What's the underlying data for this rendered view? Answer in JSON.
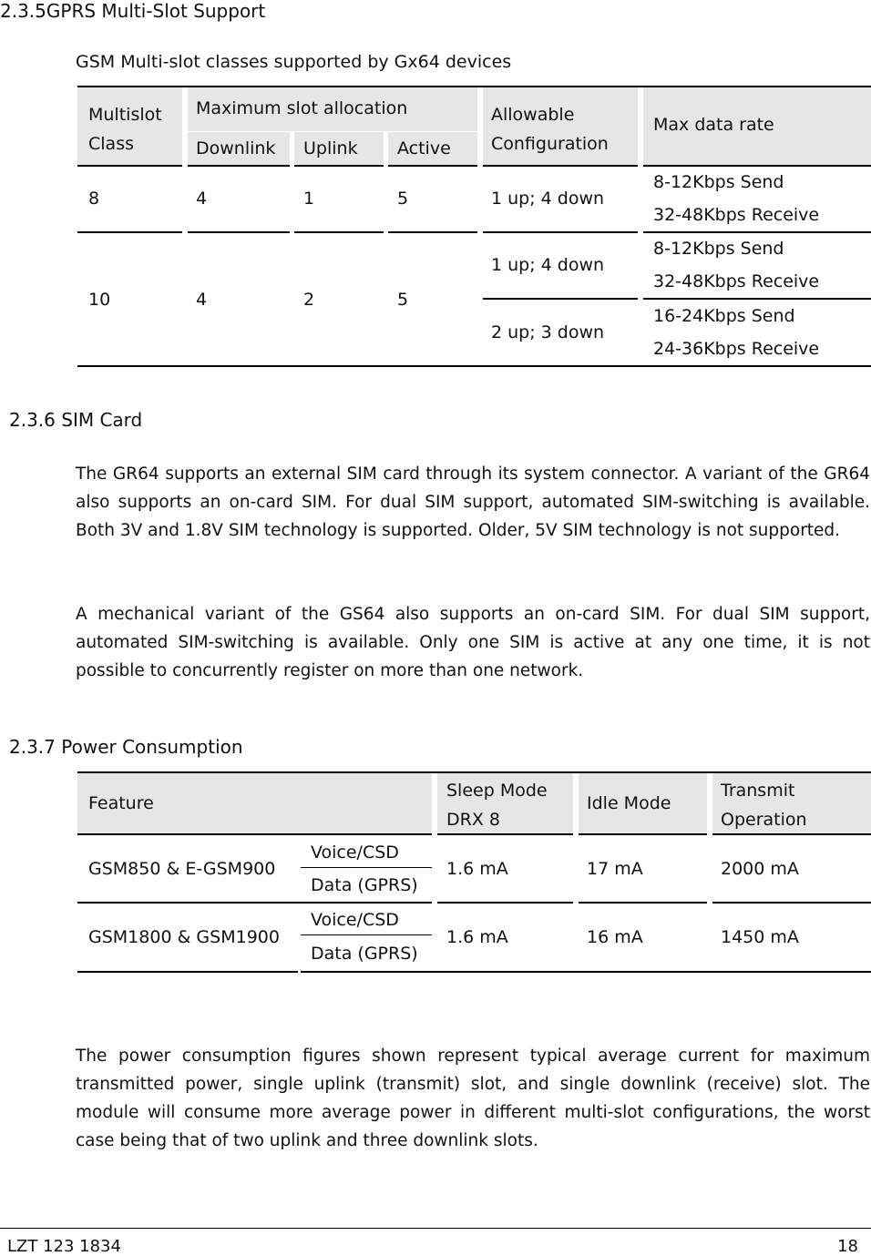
{
  "sections": {
    "s235": {
      "title": "2.3.5GPRS Multi-Slot Support",
      "caption": "GSM Multi-slot classes supported by Gx64 devices"
    },
    "s236": {
      "title": "2.3.6 SIM Card"
    },
    "s237": {
      "title": "2.3.7 Power Consumption"
    }
  },
  "multislot_table": {
    "headers": {
      "class": [
        "Multislot",
        "Class"
      ],
      "max_slot": "Maximum slot allocation",
      "downlink": "Downlink",
      "uplink": "Uplink",
      "active": "Active",
      "config": [
        "Allowable",
        "Configuration"
      ],
      "rate": "Max data rate"
    },
    "rows": [
      {
        "class": "8",
        "downlink": "4",
        "uplink": "1",
        "active": "5",
        "configs": [
          {
            "config": "1 up; 4 down",
            "send": "8-12Kbps Send",
            "receive": "32-48Kbps Receive"
          }
        ]
      },
      {
        "class": "10",
        "downlink": "4",
        "uplink": "2",
        "active": "5",
        "configs": [
          {
            "config": "1 up; 4 down",
            "send": "8-12Kbps Send",
            "receive": "32-48Kbps Receive"
          },
          {
            "config": "2 up; 3 down",
            "send": "16-24Kbps Send",
            "receive": "24-36Kbps Receive"
          }
        ]
      }
    ]
  },
  "sim_paragraphs": [
    "The GR64 supports an external SIM card through its system connector.  A variant of the GR64 also supports an on-card SIM.  For dual SIM support, automated SIM-switching is available.  Both 3V and 1.8V SIM technology is supported.  Older, 5V SIM technology is not supported.",
    "A mechanical variant of the GS64 also supports an on-card SIM.  For dual SIM support, automated SIM-switching is available.  Only one SIM is active at any one time, it is not possible to concurrently register on more than one network."
  ],
  "power_table": {
    "headers": {
      "feature": "Feature",
      "sleep": [
        "Sleep Mode",
        "DRX 8"
      ],
      "idle": "Idle Mode",
      "transmit": [
        "Transmit",
        "Operation"
      ]
    },
    "rows": [
      {
        "feature": "GSM850 & E-GSM900",
        "modes": [
          "Voice/CSD",
          "Data (GPRS)"
        ],
        "sleep": "1.6 mA",
        "idle": "17 mA",
        "transmit": "2000 mA"
      },
      {
        "feature": "GSM1800 & GSM1900",
        "modes": [
          "Voice/CSD",
          "Data (GPRS)"
        ],
        "sleep": "1.6 mA",
        "idle": "16 mA",
        "transmit": "1450 mA"
      }
    ]
  },
  "power_note": "The power consumption figures shown represent typical average current for maximum transmitted power, single uplink (transmit) slot, and single downlink (receive) slot.  The module will consume more average power in different multi-slot configurations, the worst case being that of two uplink and three downlink slots.",
  "footer": {
    "doc_id": "LZT 123 1834",
    "page": "18"
  }
}
